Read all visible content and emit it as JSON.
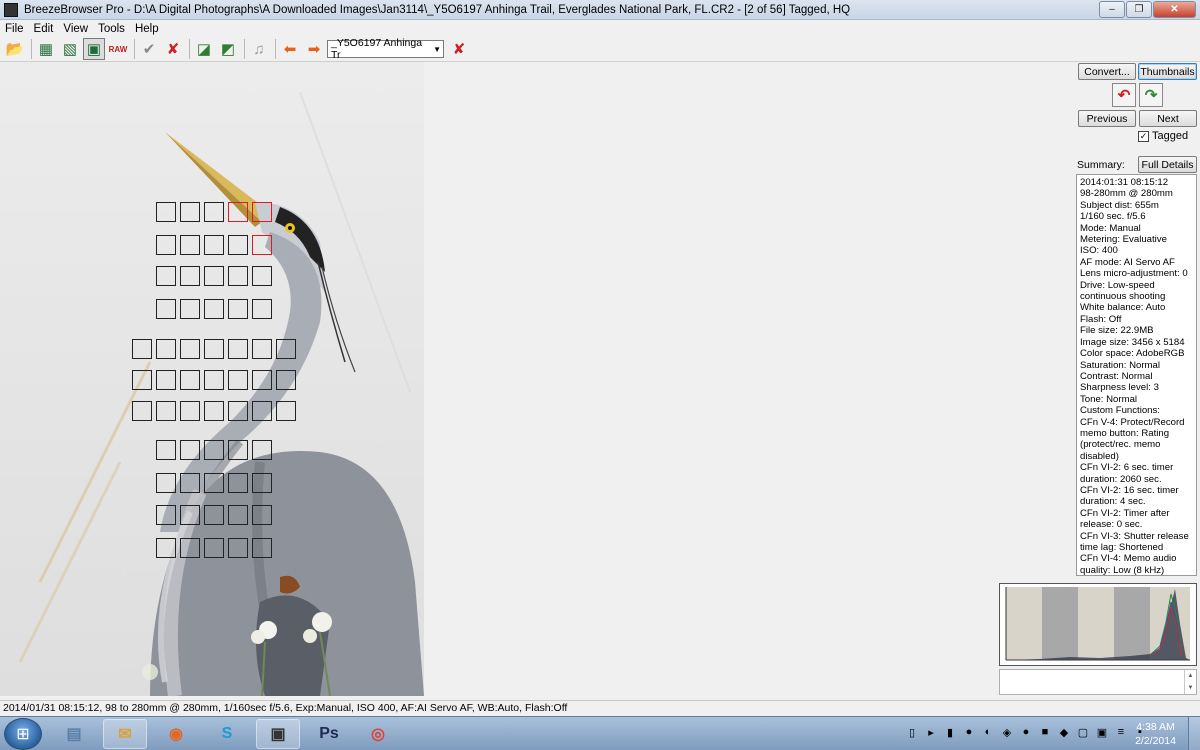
{
  "window": {
    "title": "BreezeBrowser Pro - D:\\A Digital Photographs\\A Downloaded Images\\Jan3114\\_Y5O6197  Anhinga  Trail, Everglades National Park, FL.CR2 - [2 of 56] Tagged, HQ",
    "minimize": "–",
    "restore": "❐",
    "close": "✕"
  },
  "menu": [
    "File",
    "Edit",
    "View",
    "Tools",
    "Help"
  ],
  "toolbar": {
    "file_select_value": "_Y5O6197  Anhinga  Tr",
    "file_select_arrow": "▼",
    "icons": {
      "open": "📂",
      "grid": "▦",
      "grid_image": "▧",
      "single_image": "▣",
      "raw": "RAW",
      "tag_check": "✔",
      "untag": "✘",
      "before_after_1": "◪",
      "before_after_2": "◩",
      "music": "♫",
      "prev_arrow": "⬅",
      "next_arrow": "➡",
      "delete": "✘"
    }
  },
  "right_panel": {
    "convert_button": "Convert...",
    "thumbnails_button": "Thumbnails",
    "rotate_left_icon": "↶",
    "rotate_right_icon": "↷",
    "previous_button": "Previous",
    "next_button": "Next",
    "tagged_label": "Tagged",
    "tagged_checked": true,
    "checkmark": "✓",
    "summary_label": "Summary:",
    "full_details_button": "Full Details",
    "details": [
      "2014:01:31 08:15:12",
      "98-280mm @ 280mm",
      "Subject dist: 655m",
      "1/160 sec. f/5.6",
      "Mode: Manual",
      "Metering: Evaluative",
      "ISO: 400",
      "AF mode: AI Servo AF",
      "Lens micro-adjustment: 0",
      "Drive: Low-speed continuous shooting",
      "White balance: Auto",
      "Flash: Off",
      "File size: 22.9MB",
      "Image size: 3456 x 5184",
      "Color space: AdobeRGB",
      "Saturation: Normal",
      "Contrast: Normal",
      "Sharpness level: 3",
      "Tone: Normal",
      "Custom Functions:",
      "CFn V-4: Protect/Record memo button: Rating (protect/rec. memo disabled)",
      "CFn VI-2: 6 sec. timer duration: 2060 sec.",
      "CFn VI-2: 16 sec. timer duration: 4 sec.",
      "CFn VI-2: Timer after release: 0 sec.",
      "CFn VI-3: Shutter release time lag: Shortened",
      "CFn VI-4: Memo audio quality: Low (8 kHz)"
    ],
    "spin_up": "▲",
    "spin_down": "▼"
  },
  "af_points": {
    "rows": [
      [
        0,
        0,
        0,
        1,
        1
      ],
      [
        0,
        0,
        0,
        0,
        1
      ],
      [
        0,
        0,
        0,
        0,
        0
      ],
      [
        0,
        0,
        0,
        0,
        0
      ],
      [
        0,
        0,
        0,
        0,
        0,
        0,
        0
      ],
      [
        0,
        0,
        0,
        0,
        0,
        0,
        0
      ],
      [
        0,
        0,
        0,
        0,
        0,
        0,
        0
      ],
      [
        0,
        0,
        0,
        0,
        0
      ],
      [
        0,
        0,
        0,
        0,
        0
      ],
      [
        0,
        0,
        0,
        0,
        0
      ],
      [
        0,
        0,
        0,
        0,
        0
      ]
    ]
  },
  "status": "2014/01/31 08:15:12, 98 to 280mm @ 280mm, 1/160sec f/5.6, Exp:Manual, ISO 400, AF:AI Servo AF, WB:Auto, Flash:Off",
  "taskbar": {
    "start_icon": "⊞",
    "apps": [
      {
        "name": "calculator",
        "icon": "▤",
        "running": false
      },
      {
        "name": "mail",
        "icon": "✉",
        "running": true
      },
      {
        "name": "firefox",
        "icon": "◉",
        "running": false
      },
      {
        "name": "skype",
        "icon": "S",
        "running": false
      },
      {
        "name": "camera",
        "icon": "▣",
        "running": true
      },
      {
        "name": "photoshop",
        "icon": "Ps",
        "running": false
      },
      {
        "name": "chrome",
        "icon": "◎",
        "running": false
      }
    ],
    "tray_icons": [
      "▯",
      "▸",
      "▮",
      "●",
      "◐",
      "◈",
      "●",
      "■",
      "◆",
      "▢",
      "▣",
      "≡",
      "▪"
    ],
    "time": "4:38 AM",
    "date": "2/2/2014"
  },
  "colors": {
    "af_active": "#d42020",
    "af_inactive": "#222222"
  }
}
